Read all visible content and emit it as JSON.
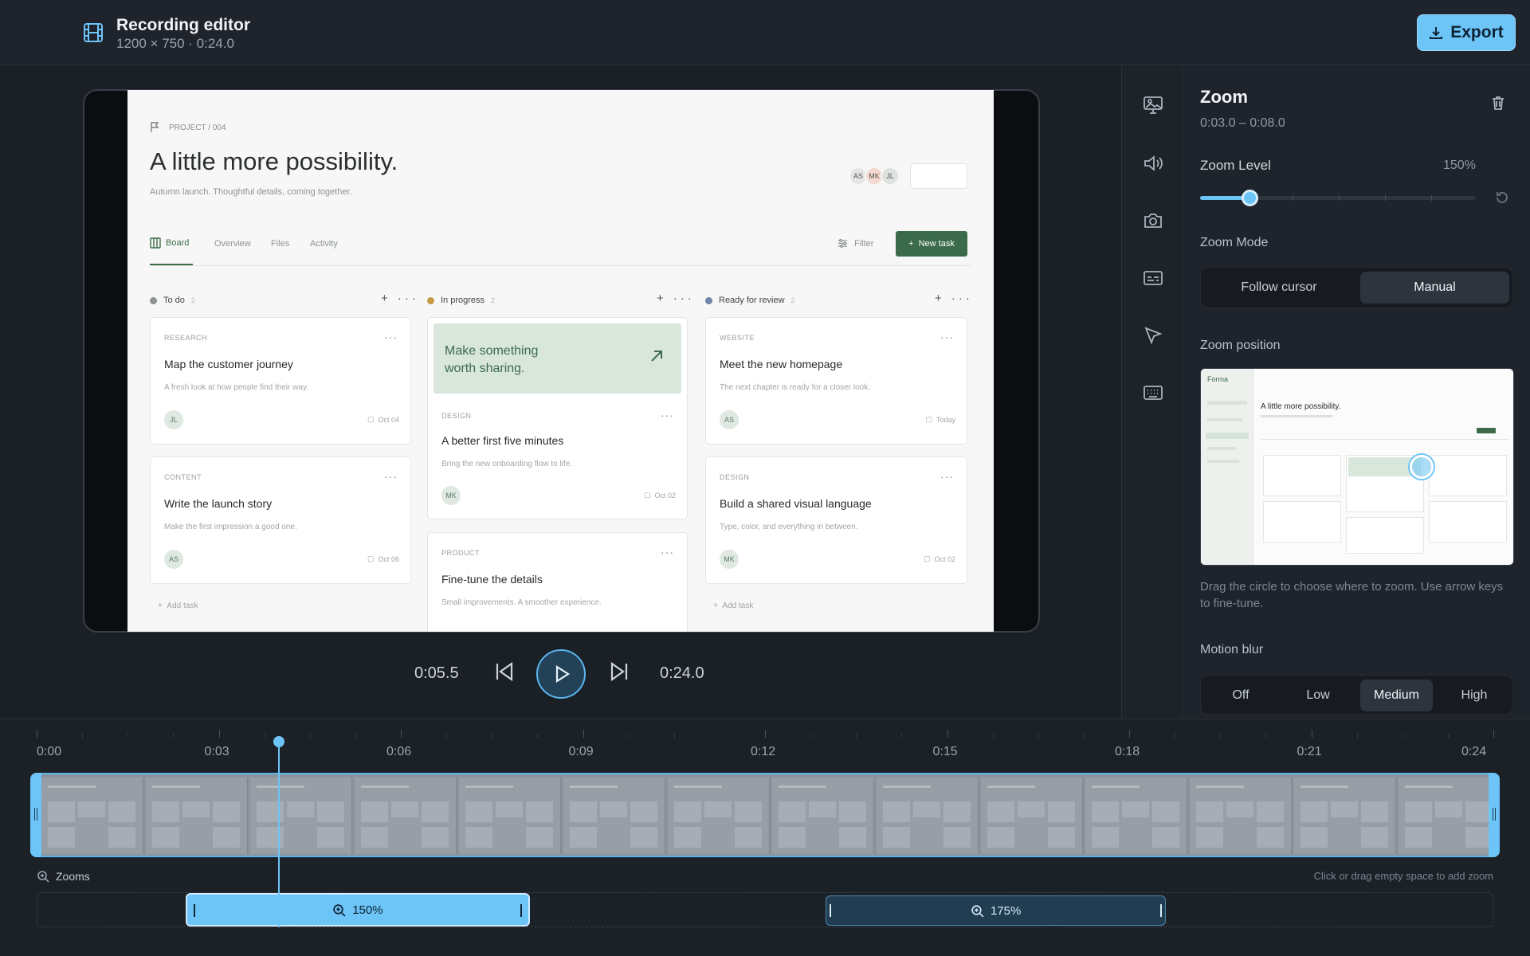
{
  "header": {
    "title": "Recording editor",
    "subtitle": "1200 × 750 · 0:24.0",
    "export_label": "Export"
  },
  "preview": {
    "breadcrumb": "PROJECT / 004",
    "heading": "A little more possibility.",
    "tagline": "Autumn launch. Thoughtful details, coming together.",
    "avatars": [
      "AS",
      "MK",
      "JL"
    ],
    "tabs": [
      "Board",
      "Overview",
      "Files",
      "Activity"
    ],
    "filter": "Filter",
    "new_task": "New task",
    "columns": [
      {
        "name": "To do",
        "count": "2",
        "color": "#8e948f"
      },
      {
        "name": "In progress",
        "count": "2",
        "color": "#c79a45"
      },
      {
        "name": "Ready for review",
        "count": "2",
        "color": "#6d86a8"
      }
    ],
    "cards": {
      "c1": {
        "tag": "RESEARCH",
        "title": "Map the customer journey",
        "desc": "A fresh look at how people find their way.",
        "avatar": "JL",
        "date": "Oct 04"
      },
      "c2": {
        "tag": "CONTENT",
        "title": "Write the launch story",
        "desc": "Make the first impression a good one.",
        "avatar": "AS",
        "date": "Oct 06"
      },
      "c3": {
        "banner": "Make something\nworth sharing.",
        "tag": "DESIGN",
        "title": "A better first five minutes",
        "desc": "Bring the new onboarding flow to life.",
        "avatar": "MK",
        "date": "Oct 02"
      },
      "c4": {
        "tag": "PRODUCT",
        "title": "Fine-tune the details",
        "desc": "Small improvements. A smoother experience."
      },
      "c5": {
        "tag": "WEBSITE",
        "title": "Meet the new homepage",
        "desc": "The next chapter is ready for a closer look.",
        "avatar": "AS",
        "date": "Today"
      },
      "c6": {
        "tag": "DESIGN",
        "title": "Build a shared visual language",
        "desc": "Type, color, and everything in between.",
        "avatar": "MK",
        "date": "Oct 02"
      }
    },
    "add_task": "Add task"
  },
  "playback": {
    "current": "0:05.5",
    "total": "0:24.0"
  },
  "panel": {
    "title": "Zoom",
    "range": "0:03.0 – 0:08.0",
    "zoom_level_label": "Zoom Level",
    "zoom_level_value": "150%",
    "zoom_level_fraction": 0.18,
    "zoom_mode_label": "Zoom Mode",
    "mode_options": [
      "Follow cursor",
      "Manual"
    ],
    "mode_selected": "Manual",
    "position_label": "Zoom position",
    "mini": {
      "brand": "Forma",
      "heading": "A little more possibility."
    },
    "help": "Drag the circle to choose where to zoom. Use arrow keys to fine-tune.",
    "blur_label": "Motion blur",
    "blur_options": [
      "Off",
      "Low",
      "Medium",
      "High"
    ],
    "blur_selected": "Medium"
  },
  "timeline": {
    "ticks": [
      "0:00",
      "0:03",
      "0:06",
      "0:09",
      "0:12",
      "0:15",
      "0:18",
      "0:21",
      "0:24"
    ],
    "playhead_seconds": 5.5,
    "zooms_label": "Zooms",
    "zooms_hint": "Click or drag empty space to add zoom",
    "clips": [
      {
        "label": "150%",
        "start": 3.0,
        "end": 8.0
      },
      {
        "label": "175%",
        "start": 13.0,
        "end": 19.0
      }
    ],
    "accent": "#6cc4f7"
  }
}
